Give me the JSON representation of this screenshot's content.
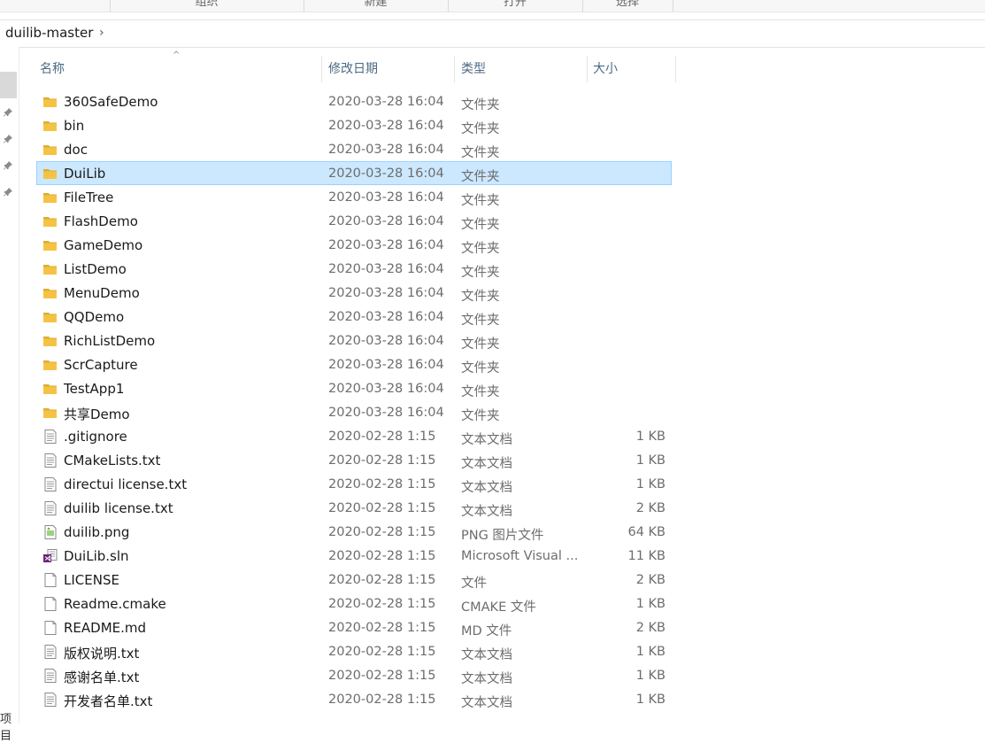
{
  "ribbon": {
    "groups": [
      "组织",
      "新建",
      "打开",
      "选择"
    ]
  },
  "address": {
    "crumb": "duilib-master",
    "chevron": "›"
  },
  "navpane": {
    "footer_text": "项目"
  },
  "columns": {
    "name": "名称",
    "modified": "修改日期",
    "type": "类型",
    "size": "大小"
  },
  "files": [
    {
      "name": "360SafeDemo",
      "date": "2020-03-28 16:04",
      "type": "文件夹",
      "size": "",
      "icon": "folder-icon"
    },
    {
      "name": "bin",
      "date": "2020-03-28 16:04",
      "type": "文件夹",
      "size": "",
      "icon": "folder-icon"
    },
    {
      "name": "doc",
      "date": "2020-03-28 16:04",
      "type": "文件夹",
      "size": "",
      "icon": "folder-icon"
    },
    {
      "name": "DuiLib",
      "date": "2020-03-28 16:04",
      "type": "文件夹",
      "size": "",
      "icon": "folder-icon",
      "selected": true
    },
    {
      "name": "FileTree",
      "date": "2020-03-28 16:04",
      "type": "文件夹",
      "size": "",
      "icon": "folder-icon"
    },
    {
      "name": "FlashDemo",
      "date": "2020-03-28 16:04",
      "type": "文件夹",
      "size": "",
      "icon": "folder-icon"
    },
    {
      "name": "GameDemo",
      "date": "2020-03-28 16:04",
      "type": "文件夹",
      "size": "",
      "icon": "folder-icon"
    },
    {
      "name": "ListDemo",
      "date": "2020-03-28 16:04",
      "type": "文件夹",
      "size": "",
      "icon": "folder-icon"
    },
    {
      "name": "MenuDemo",
      "date": "2020-03-28 16:04",
      "type": "文件夹",
      "size": "",
      "icon": "folder-icon"
    },
    {
      "name": "QQDemo",
      "date": "2020-03-28 16:04",
      "type": "文件夹",
      "size": "",
      "icon": "folder-icon"
    },
    {
      "name": "RichListDemo",
      "date": "2020-03-28 16:04",
      "type": "文件夹",
      "size": "",
      "icon": "folder-icon"
    },
    {
      "name": "ScrCapture",
      "date": "2020-03-28 16:04",
      "type": "文件夹",
      "size": "",
      "icon": "folder-icon"
    },
    {
      "name": "TestApp1",
      "date": "2020-03-28 16:04",
      "type": "文件夹",
      "size": "",
      "icon": "folder-icon"
    },
    {
      "name": "共享Demo",
      "date": "2020-03-28 16:04",
      "type": "文件夹",
      "size": "",
      "icon": "folder-icon"
    },
    {
      "name": ".gitignore",
      "date": "2020-02-28 1:15",
      "type": "文本文档",
      "size": "1 KB",
      "icon": "text-file-icon"
    },
    {
      "name": "CMakeLists.txt",
      "date": "2020-02-28 1:15",
      "type": "文本文档",
      "size": "1 KB",
      "icon": "text-file-icon"
    },
    {
      "name": "directui license.txt",
      "date": "2020-02-28 1:15",
      "type": "文本文档",
      "size": "1 KB",
      "icon": "text-file-icon"
    },
    {
      "name": "duilib license.txt",
      "date": "2020-02-28 1:15",
      "type": "文本文档",
      "size": "2 KB",
      "icon": "text-file-icon"
    },
    {
      "name": "duilib.png",
      "date": "2020-02-28 1:15",
      "type": "PNG 图片文件",
      "size": "64 KB",
      "icon": "image-file-icon"
    },
    {
      "name": "DuiLib.sln",
      "date": "2020-02-28 1:15",
      "type": "Microsoft Visual ...",
      "size": "11 KB",
      "icon": "visual-studio-solution-icon"
    },
    {
      "name": "LICENSE",
      "date": "2020-02-28 1:15",
      "type": "文件",
      "size": "2 KB",
      "icon": "blank-file-icon"
    },
    {
      "name": "Readme.cmake",
      "date": "2020-02-28 1:15",
      "type": "CMAKE 文件",
      "size": "1 KB",
      "icon": "blank-file-icon"
    },
    {
      "name": "README.md",
      "date": "2020-02-28 1:15",
      "type": "MD 文件",
      "size": "2 KB",
      "icon": "blank-file-icon"
    },
    {
      "name": "版权说明.txt",
      "date": "2020-02-28 1:15",
      "type": "文本文档",
      "size": "1 KB",
      "icon": "text-file-icon"
    },
    {
      "name": "感谢名单.txt",
      "date": "2020-02-28 1:15",
      "type": "文本文档",
      "size": "1 KB",
      "icon": "text-file-icon"
    },
    {
      "name": "开发者名单.txt",
      "date": "2020-02-28 1:15",
      "type": "文本文档",
      "size": "1 KB",
      "icon": "text-file-icon"
    }
  ],
  "colors": {
    "selection_bg": "#cce8ff",
    "selection_border": "#99d1ff",
    "folder": "#f5c343",
    "header_text": "#4d6a85"
  }
}
